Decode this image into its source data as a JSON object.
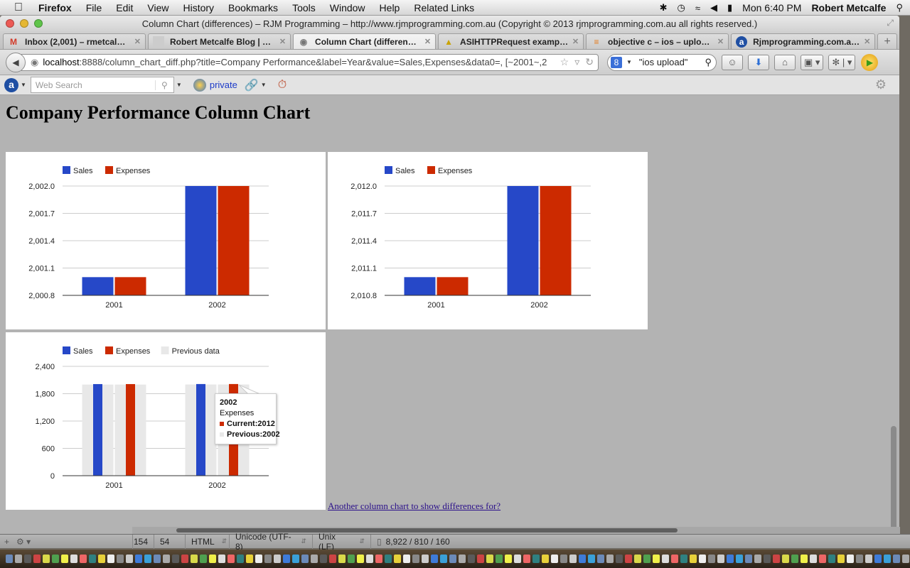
{
  "menubar": {
    "app": "Firefox",
    "items": [
      "File",
      "Edit",
      "View",
      "History",
      "Bookmarks",
      "Tools",
      "Window",
      "Help",
      "Related Links"
    ],
    "clock": "Mon 6:40 PM",
    "user": "Robert Metcalfe"
  },
  "window": {
    "title": "Column Chart (differences) – RJM Programming – http://www.rjmprogramming.com.au (Copyright © 2013 rjmprogramming.com.au all rights reserved.)"
  },
  "tabs": [
    {
      "label": "Inbox (2,001) – rmetcal…",
      "icon": "gmail-icon",
      "active": false
    },
    {
      "label": "Robert Metcalfe Blog | …",
      "icon": "blog-icon",
      "active": false
    },
    {
      "label": "Column Chart (differen…",
      "icon": "globe-icon",
      "active": true
    },
    {
      "label": "ASIHTTPRequest examp…",
      "icon": "warning-icon",
      "active": false
    },
    {
      "label": "objective c – ios – uplo…",
      "icon": "stackoverflow-icon",
      "active": false
    },
    {
      "label": "Rjmprogramming.com.a…",
      "icon": "ask-icon",
      "active": false
    }
  ],
  "navbar": {
    "url_host": "localhost",
    "url_rest": ":8888/column_chart_diff.php?title=Company Performance&label=Year&value=Sales,Expenses&data0=, [~2001~,2",
    "search_value": "\"ios upload\""
  },
  "addonbar": {
    "websearch_placeholder": "Web Search",
    "private_label": "private"
  },
  "page": {
    "title": "Company Performance Column Chart",
    "link": "Another column chart to show differences for?"
  },
  "colors": {
    "sales": "#2648c8",
    "expenses": "#cc2a00",
    "previous": "#e8e8e8",
    "grid": "#cccccc",
    "axis": "#333333"
  },
  "chart_data": [
    {
      "type": "bar",
      "title": "",
      "categories": [
        "2001",
        "2002"
      ],
      "series": [
        {
          "name": "Sales",
          "values": [
            2001,
            2002
          ]
        },
        {
          "name": "Expenses",
          "values": [
            2001,
            2002
          ]
        }
      ],
      "ylim": [
        2000.8,
        2002.0
      ],
      "yticks": [
        "2,000.8",
        "2,001.1",
        "2,001.4",
        "2,001.7",
        "2,002.0"
      ],
      "ytick_values": [
        2000.8,
        2001.1,
        2001.4,
        2001.7,
        2002.0
      ],
      "grid": true,
      "legend": "top"
    },
    {
      "type": "bar",
      "title": "",
      "categories": [
        "2001",
        "2002"
      ],
      "series": [
        {
          "name": "Sales",
          "values": [
            2011,
            2012
          ]
        },
        {
          "name": "Expenses",
          "values": [
            2011,
            2012
          ]
        }
      ],
      "ylim": [
        2010.8,
        2012.0
      ],
      "yticks": [
        "2,010.8",
        "2,011.1",
        "2,011.4",
        "2,011.7",
        "2,012.0"
      ],
      "ytick_values": [
        2010.8,
        2011.1,
        2011.4,
        2011.7,
        2012.0
      ],
      "grid": true,
      "legend": "top"
    },
    {
      "type": "bar",
      "title": "",
      "diff": true,
      "categories": [
        "2001",
        "2002"
      ],
      "series": [
        {
          "name": "Sales",
          "values": [
            2011,
            2012
          ],
          "previous": [
            2001,
            2002
          ]
        },
        {
          "name": "Expenses",
          "values": [
            2011,
            2012
          ],
          "previous": [
            2001,
            2002
          ]
        }
      ],
      "legend_entries": [
        "Sales",
        "Expenses",
        "Previous data"
      ],
      "ylim": [
        0,
        2400
      ],
      "yticks": [
        "0",
        "600",
        "1,200",
        "1,800",
        "2,400"
      ],
      "ytick_values": [
        0,
        600,
        1200,
        1800,
        2400
      ],
      "grid": true,
      "legend": "top",
      "tooltip": {
        "category": "2002",
        "series": "Expenses",
        "current": "Current:2012",
        "previous": "Previous:2002"
      }
    }
  ],
  "statusbar": {
    "line": "154",
    "col": "54",
    "syntax": "HTML",
    "encoding": "Unicode (UTF-8)",
    "line_endings": "Unix (LF)",
    "stats": "8,922 / 810 / 160"
  }
}
